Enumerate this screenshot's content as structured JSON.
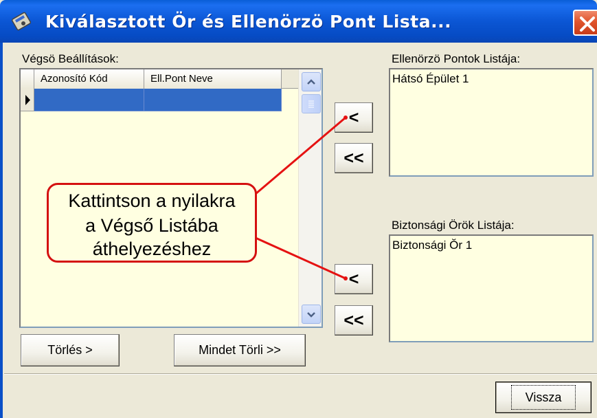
{
  "window": {
    "title": "Kiválasztott Ör és Ellenörzö Pont Lista...",
    "icon": "app-icon",
    "close_icon": "close-icon"
  },
  "final_settings": {
    "label": "Végsö Beállítások:",
    "columns": [
      "Azonosító Kód",
      "Ell.Pont Neve"
    ]
  },
  "checkpoints": {
    "label": "Ellenörzö Pontok Listája:",
    "items": [
      "Hátsó Épület 1"
    ]
  },
  "guards": {
    "label": "Biztonsági Örök Listája:",
    "items": [
      "Biztonsági Ŏr 1"
    ]
  },
  "buttons": {
    "move_one": "<",
    "move_all": "<<",
    "delete": "Törlés >",
    "delete_all": "Mindet Törli >>",
    "back": "Vissza"
  },
  "callout": {
    "lines": [
      "Kattintson a nyilakra",
      "a Végső Listába",
      "áthelyezéshez"
    ],
    "color": "#d41010"
  }
}
